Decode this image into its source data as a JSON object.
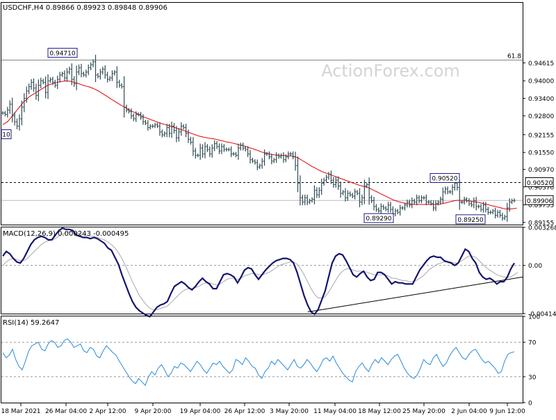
{
  "chart_data": [
    {
      "type": "candlestick",
      "title": "USDCHF,H4  0.89866 0.89923 0.89848 0.89906",
      "watermark": "ActionForex.com",
      "ylim": [
        0.8908,
        0.9667
      ],
      "y_ticks": [
        "0.94615",
        "0.94000",
        "0.93400",
        "0.92800",
        "0.92155",
        "0.91550",
        "0.90970",
        "0.90370",
        "0.89755",
        "0.89155"
      ],
      "x_ticks": [
        "18 Mar 2021",
        "26 Mar 04:00",
        "2 Apr 12:00",
        "9 Apr 20:00",
        "19 Apr 04:00",
        "26 Apr 12:00",
        "3 May 20:00",
        "11 May 04:00",
        "18 May 12:00",
        "25 May 20:00",
        "2 Jun 04:00",
        "9 Jun 12:00"
      ],
      "fib_label": "61.8",
      "fib_level": 0.9471,
      "resistance_dashed": 0.9052,
      "last_price": 0.89906,
      "side_label": "10",
      "annotations": [
        {
          "label": "0.94710",
          "value": 0.9471
        },
        {
          "label": "0.90520",
          "value": 0.9052
        },
        {
          "label": "0.89290",
          "value": 0.8929
        },
        {
          "label": "0.89250",
          "value": 0.8925
        }
      ],
      "price_tags": [
        {
          "label": "0.90520",
          "value": 0.9052
        },
        {
          "label": "0.89906",
          "value": 0.89906
        }
      ],
      "close": [
        0.929,
        0.9285,
        0.93,
        0.932,
        0.928,
        0.926,
        0.9245,
        0.927,
        0.931,
        0.934,
        0.9365,
        0.938,
        0.9395,
        0.9375,
        0.935,
        0.9385,
        0.94,
        0.9395,
        0.936,
        0.94,
        0.9405,
        0.9395,
        0.9385,
        0.9405,
        0.942,
        0.9425,
        0.941,
        0.943,
        0.944,
        0.9405,
        0.939,
        0.943,
        0.9445,
        0.9425,
        0.942,
        0.943,
        0.9445,
        0.9455,
        0.9465,
        0.942,
        0.9415,
        0.943,
        0.944,
        0.942,
        0.9405,
        0.941,
        0.9425,
        0.943,
        0.9395,
        0.9385,
        0.938,
        0.931,
        0.93,
        0.9295,
        0.928,
        0.927,
        0.9285,
        0.9285,
        0.9275,
        0.926,
        0.9255,
        0.924,
        0.9245,
        0.9245,
        0.925,
        0.9245,
        0.9225,
        0.9215,
        0.922,
        0.924,
        0.922,
        0.9245,
        0.923,
        0.9205,
        0.9225,
        0.9245,
        0.924,
        0.922,
        0.92,
        0.919,
        0.916,
        0.9145,
        0.9145,
        0.917,
        0.915,
        0.9175,
        0.9165,
        0.915,
        0.917,
        0.9185,
        0.9175,
        0.916,
        0.9175,
        0.9165,
        0.9165,
        0.9165,
        0.915,
        0.915,
        0.9145,
        0.917,
        0.918,
        0.917,
        0.9165,
        0.915,
        0.913,
        0.9125,
        0.912,
        0.9105,
        0.911,
        0.9125,
        0.915,
        0.915,
        0.914,
        0.9125,
        0.913,
        0.9145,
        0.914,
        0.9145,
        0.913,
        0.914,
        0.915,
        0.915,
        0.914,
        0.911,
        0.905,
        0.9,
        0.8985,
        0.9,
        0.8985,
        0.899,
        0.8995,
        0.9025,
        0.901,
        0.9025,
        0.905,
        0.906,
        0.907,
        0.908,
        0.906,
        0.9045,
        0.906,
        0.904,
        0.9015,
        0.902,
        0.9,
        0.9015,
        0.901,
        0.9005,
        0.902,
        0.9015,
        0.8985,
        0.9,
        0.904,
        0.9045,
        0.9,
        0.899,
        0.897,
        0.896,
        0.8955,
        0.897,
        0.8965,
        0.896,
        0.8975,
        0.896,
        0.8945,
        0.8955,
        0.895,
        0.8965,
        0.8965,
        0.8975,
        0.8985,
        0.8975,
        0.899,
        0.8985,
        0.9,
        0.899,
        0.9,
        0.9,
        0.8985,
        0.8985,
        0.898,
        0.8965,
        0.898,
        0.8985,
        0.8995,
        0.902,
        0.903,
        0.902,
        0.902,
        0.9035,
        0.905,
        0.9035,
        0.8985,
        0.8985,
        0.8995,
        0.899,
        0.898,
        0.8975,
        0.899,
        0.897,
        0.897,
        0.896,
        0.8975,
        0.896,
        0.895,
        0.895,
        0.8955,
        0.894,
        0.895,
        0.894,
        0.893,
        0.8935,
        0.8965,
        0.8985,
        0.899,
        0.8991
      ],
      "ma_close": [
        0.925,
        0.9255,
        0.926,
        0.927,
        0.928,
        0.929,
        0.93,
        0.931,
        0.932,
        0.933,
        0.9335,
        0.9345,
        0.935,
        0.9355,
        0.936,
        0.9365,
        0.937,
        0.9375,
        0.938,
        0.9385,
        0.9388,
        0.939,
        0.9393,
        0.9395,
        0.9397,
        0.9398,
        0.9399,
        0.9399,
        0.9399,
        0.9397,
        0.9395,
        0.9393,
        0.939,
        0.9387,
        0.9384,
        0.9382,
        0.938,
        0.9377,
        0.9374,
        0.937,
        0.9366,
        0.9361,
        0.9356,
        0.9351,
        0.9346,
        0.934,
        0.9335,
        0.933,
        0.9325,
        0.932,
        0.9315,
        0.9311,
        0.9306,
        0.9301,
        0.9297,
        0.9293,
        0.929,
        0.9285,
        0.9281,
        0.9277,
        0.9274,
        0.9271,
        0.9268,
        0.9265,
        0.9262,
        0.9259,
        0.9256,
        0.9253,
        0.9251,
        0.9249,
        0.9246,
        0.9243,
        0.9241,
        0.9238,
        0.9236,
        0.9233,
        0.923,
        0.9227,
        0.9224,
        0.9221,
        0.9218,
        0.9215,
        0.9212,
        0.921,
        0.9208,
        0.9206,
        0.9205,
        0.9203,
        0.9202,
        0.9201,
        0.9199,
        0.9197,
        0.9195,
        0.9193,
        0.9191,
        0.919,
        0.9188,
        0.9186,
        0.9184,
        0.9182,
        0.918,
        0.9178,
        0.9176,
        0.9173,
        0.917,
        0.9168,
        0.9165,
        0.9162,
        0.9159,
        0.9156,
        0.9154,
        0.9152,
        0.915,
        0.9148,
        0.9147,
        0.9146,
        0.9145,
        0.9145,
        0.9144,
        0.9144,
        0.9143,
        0.9143,
        0.9142,
        0.914,
        0.9136,
        0.9132,
        0.9127,
        0.9122,
        0.9117,
        0.9112,
        0.9107,
        0.9103,
        0.9098,
        0.9094,
        0.909,
        0.9087,
        0.9084,
        0.9081,
        0.9078,
        0.9075,
        0.9072,
        0.9069,
        0.9066,
        0.9063,
        0.906,
        0.9057,
        0.9054,
        0.9051,
        0.9048,
        0.9045,
        0.9042,
        0.904,
        0.9038,
        0.9036,
        0.9033,
        0.9029,
        0.9025,
        0.9021,
        0.9017,
        0.9013,
        0.9009,
        0.9005,
        0.9001,
        0.8997,
        0.8993,
        0.899,
        0.8987,
        0.8985,
        0.8983,
        0.8981,
        0.898,
        0.8979,
        0.8978,
        0.8977,
        0.8977,
        0.8977,
        0.8977,
        0.8977,
        0.8977,
        0.8977,
        0.8977,
        0.8977,
        0.8977,
        0.8978,
        0.8979,
        0.898,
        0.8982,
        0.8984,
        0.8986,
        0.8988,
        0.899,
        0.8991,
        0.8991,
        0.8991,
        0.8991,
        0.899,
        0.8989,
        0.8988,
        0.8986,
        0.8985,
        0.8984,
        0.8982,
        0.898,
        0.8978,
        0.8976,
        0.8974,
        0.8972,
        0.897,
        0.8968,
        0.8966,
        0.8964,
        0.8962,
        0.8961,
        0.8961,
        0.8962,
        0.8963,
        0.8964
      ]
    },
    {
      "type": "line",
      "title": "MACD(12,26,9) 0.000243 -0.000495",
      "ylim": [
        -0.004144,
        0.003268
      ],
      "y_ticks": [
        "0.003268",
        "0.00",
        "-0.004144"
      ],
      "macd": [
        0.0008,
        0.0012,
        0.001,
        0.0006,
        0.0003,
        0.0002,
        0.0006,
        0.0012,
        0.0018,
        0.0022,
        0.0024,
        0.0025,
        0.0024,
        0.0022,
        0.0022,
        0.0026,
        0.003,
        0.0032,
        0.0031,
        0.0031,
        0.003,
        0.0026,
        0.0025,
        0.0024,
        0.0024,
        0.0023,
        0.0024,
        0.0023,
        0.0021,
        0.0019,
        0.0015,
        0.0013,
        0.0007,
        0.0001,
        -0.0008,
        -0.0016,
        -0.0024,
        -0.0031,
        -0.0036,
        -0.0039,
        -0.0041,
        -0.0043,
        -0.0044,
        -0.004,
        -0.0036,
        -0.0034,
        -0.0033,
        -0.0031,
        -0.0024,
        -0.0018,
        -0.0016,
        -0.0014,
        -0.0016,
        -0.0019,
        -0.0021,
        -0.0018,
        -0.0014,
        -0.0011,
        -0.0014,
        -0.0016,
        -0.002,
        -0.002,
        -0.0014,
        -0.0008,
        -0.0007,
        -0.0008,
        -0.001,
        -0.0015,
        -0.001,
        -0.0004,
        -0.0002,
        -0.0003,
        -0.0008,
        -0.0012,
        -0.0008,
        -0.0004,
        -0.0001,
        0.0002,
        0.0004,
        0.0005,
        0.0006,
        0.0006,
        0.0005,
        0.0002,
        -0.0006,
        -0.0016,
        -0.0026,
        -0.0034,
        -0.004,
        -0.0042,
        -0.0038,
        -0.003,
        -0.0022,
        -0.001,
        0.0002,
        0.0008,
        0.001,
        0.0009,
        0.0004,
        -0.0002,
        -0.0008,
        -0.001,
        -0.0007,
        -0.0005,
        -0.001,
        -0.0013,
        -0.0012,
        -0.0006,
        -0.0006,
        -0.0008,
        -0.0012,
        -0.0016,
        -0.0014,
        -0.0015,
        -0.0015,
        -0.0016,
        -0.0016,
        -0.0016,
        -0.001,
        -0.0004,
        0.0,
        0.0004,
        0.0007,
        0.0008,
        0.0007,
        0.0007,
        0.0004,
        0.0003,
        0.0002,
        0.0,
        0.0002,
        0.0008,
        0.0014,
        0.0012,
        0.0006,
        0.0002,
        -0.0006,
        -0.001,
        -0.0012,
        -0.0011,
        -0.0013,
        -0.0016,
        -0.0014,
        -0.0014,
        -0.001,
        -0.0003,
        0.0002
      ],
      "signal": [
        0.0,
        0.0003,
        0.0005,
        0.0006,
        0.0005,
        0.0004,
        0.0004,
        0.0006,
        0.0009,
        0.0012,
        0.0015,
        0.0018,
        0.002,
        0.0021,
        0.0022,
        0.0023,
        0.0025,
        0.0027,
        0.0028,
        0.0029,
        0.0029,
        0.0028,
        0.0027,
        0.0026,
        0.0026,
        0.0025,
        0.0025,
        0.0024,
        0.0023,
        0.0022,
        0.002,
        0.0018,
        0.0015,
        0.0011,
        0.0006,
        0.0,
        -0.0007,
        -0.0014,
        -0.002,
        -0.0026,
        -0.003,
        -0.0034,
        -0.0037,
        -0.0038,
        -0.0038,
        -0.0037,
        -0.0036,
        -0.0035,
        -0.0032,
        -0.0029,
        -0.0026,
        -0.0023,
        -0.0021,
        -0.002,
        -0.002,
        -0.0019,
        -0.0018,
        -0.0016,
        -0.0015,
        -0.0015,
        -0.0016,
        -0.0017,
        -0.0016,
        -0.0014,
        -0.0012,
        -0.0011,
        -0.0011,
        -0.0012,
        -0.0011,
        -0.0009,
        -0.0008,
        -0.0007,
        -0.0007,
        -0.0008,
        -0.0008,
        -0.0007,
        -0.0006,
        -0.0004,
        -0.0002,
        0.0,
        0.0001,
        0.0002,
        0.0003,
        0.0003,
        0.0001,
        -0.0003,
        -0.0008,
        -0.0014,
        -0.002,
        -0.0025,
        -0.0028,
        -0.0028,
        -0.0027,
        -0.0023,
        -0.0018,
        -0.0013,
        -0.0008,
        -0.0005,
        -0.0003,
        -0.0003,
        -0.0004,
        -0.0005,
        -0.0005,
        -0.0005,
        -0.0006,
        -0.0007,
        -0.0008,
        -0.0008,
        -0.0008,
        -0.0008,
        -0.0009,
        -0.0011,
        -0.0011,
        -0.0012,
        -0.0013,
        -0.0013,
        -0.0014,
        -0.0014,
        -0.0013,
        -0.0011,
        -0.0009,
        -0.0006,
        -0.0003,
        -0.0001,
        0.0001,
        0.0002,
        0.0003,
        0.0003,
        0.0003,
        0.0002,
        0.0002,
        0.0004,
        0.0006,
        0.0008,
        0.0008,
        0.0007,
        0.0004,
        0.0001,
        -0.0002,
        -0.0004,
        -0.0006,
        -0.0008,
        -0.0009,
        -0.001,
        -0.001,
        -0.001,
        -0.0008,
        -0.0006
      ],
      "trendline": [
        [
          0.5865,
          -0.004
        ],
        [
          1.0,
          -0.001
        ]
      ]
    },
    {
      "type": "line",
      "title": "RSI(14) 59.2647",
      "ylim": [
        0,
        100
      ],
      "y_ticks": [
        "100",
        "70",
        "30",
        "0"
      ],
      "levels": [
        70,
        30
      ],
      "values": [
        58,
        52,
        55,
        62,
        50,
        42,
        38,
        48,
        60,
        66,
        68,
        70,
        62,
        60,
        68,
        72,
        70,
        64,
        66,
        72,
        74,
        70,
        64,
        66,
        68,
        60,
        58,
        64,
        62,
        54,
        52,
        60,
        66,
        62,
        58,
        55,
        48,
        42,
        36,
        30,
        25,
        22,
        28,
        24,
        20,
        30,
        36,
        32,
        40,
        44,
        38,
        30,
        34,
        42,
        40,
        46,
        44,
        40,
        36,
        42,
        48,
        44,
        38,
        34,
        40,
        46,
        44,
        48,
        42,
        38,
        34,
        38,
        50,
        48,
        44,
        52,
        48,
        42,
        40,
        32,
        28,
        36,
        40,
        48,
        44,
        50,
        46,
        42,
        38,
        44,
        50,
        42,
        40,
        44,
        50,
        46,
        40,
        36,
        42,
        50,
        52,
        48,
        54,
        46,
        40,
        34,
        30,
        26,
        24,
        36,
        42,
        46,
        40,
        36,
        44,
        50,
        46,
        52,
        48,
        44,
        50,
        54,
        56,
        48,
        40,
        34,
        30,
        28,
        32,
        40,
        50,
        46,
        44,
        52,
        56,
        48,
        42,
        46,
        54,
        60,
        64,
        58,
        52,
        50,
        56,
        60,
        62,
        56,
        50,
        46,
        48,
        44,
        40,
        34,
        36,
        48,
        56,
        58,
        59
      ]
    }
  ]
}
